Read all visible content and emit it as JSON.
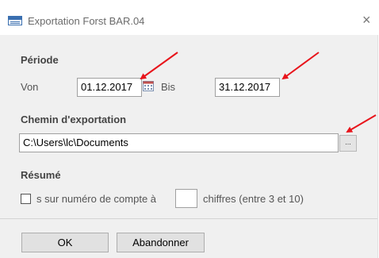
{
  "window": {
    "title": "Exportation Forst BAR.04",
    "close_glyph": "×",
    "icon": "form-icon"
  },
  "periode": {
    "heading": "Période",
    "from_label": "Von",
    "from_value": "01.12.2017",
    "to_label": "Bis",
    "to_value": "31.12.2017",
    "calendar_icon": "calendar-icon"
  },
  "export_path": {
    "heading": "Chemin d'exportation",
    "value": "C:\\Users\\lc\\Documents",
    "browse_label": "..."
  },
  "resume": {
    "heading": "Résumé",
    "checkbox_text_before": "s sur numéro de compte à",
    "checkbox_text_after": "chiffres (entre 3 et 10)",
    "checked": false
  },
  "buttons": {
    "ok": "OK",
    "cancel": "Abandonner"
  },
  "colors": {
    "annotation_arrow": "#e8141b",
    "panel_bg": "#f0f0f0"
  }
}
